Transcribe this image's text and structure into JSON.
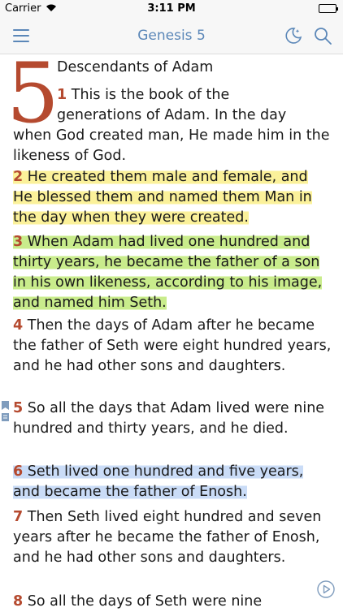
{
  "status": {
    "carrier": "Carrier",
    "time": "3:11 PM"
  },
  "nav": {
    "title": "Genesis 5"
  },
  "chapter": {
    "number": "5",
    "heading": "Descendants of Adam",
    "verse1_first_line_num": "1",
    "verse1_first_line_text": " This is the book of the",
    "verse1_second_line": "generations of Adam. In the day",
    "verse1_rest": "when God created man, He made him in the likeness of God.",
    "verses": [
      {
        "num": "2",
        "text": " He created them male and female, and He blessed them and named them Man in the day when they were created.",
        "highlight": "yellow"
      },
      {
        "num": "3",
        "text": " When Adam had lived one hundred and thirty years, he became the father of a son in his own likeness, according to his image, and named him Seth.",
        "highlight": "green"
      },
      {
        "num": "4",
        "text": " Then the days of Adam after he became the father of Seth were eight hundred years, and he had other sons and daughters.",
        "highlight": "none"
      },
      {
        "num": "5",
        "text": " So all the days that Adam lived were nine hundred and thirty years, and he died.",
        "highlight": "none"
      },
      {
        "num": "6",
        "text": " Seth lived one hundred and five years, and became the father of Enosh.",
        "highlight": "blue"
      },
      {
        "num": "7",
        "text": " Then Seth lived eight hundred and seven years after he became the father of Enosh, and he had other sons and daughters.",
        "highlight": "none"
      },
      {
        "num": "8",
        "text": " So all the days of Seth were nine",
        "highlight": "none"
      }
    ]
  },
  "colors": {
    "accent": "#5b87b8",
    "verse_number": "#b54a2f",
    "highlight_yellow": "#fbf19a",
    "highlight_green": "#c9ec8c",
    "highlight_blue": "#cadcf7"
  },
  "icons": [
    "hamburger-menu-icon",
    "night-mode-icon",
    "search-icon",
    "bookmark-note-icon",
    "play-icon",
    "wifi-icon",
    "battery-icon"
  ]
}
